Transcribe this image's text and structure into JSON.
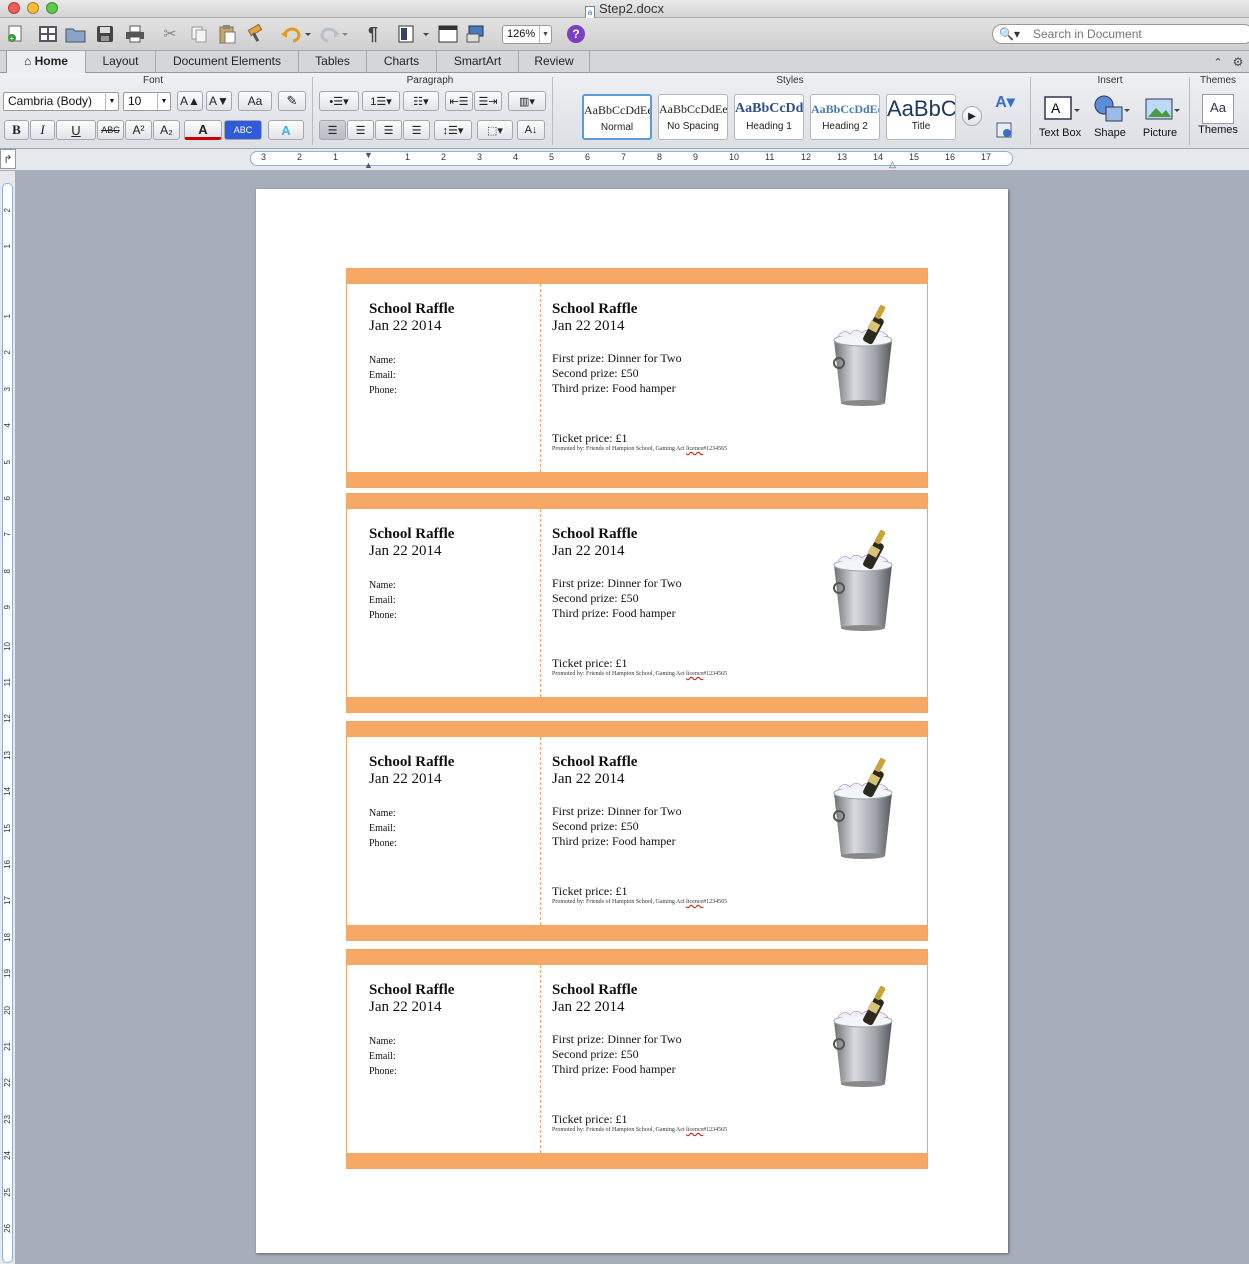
{
  "window": {
    "title": "Step2.docx"
  },
  "toolbar": {
    "zoom": "126%",
    "help": "?",
    "search_placeholder": "Search in Document"
  },
  "tabs": [
    "Home",
    "Layout",
    "Document Elements",
    "Tables",
    "Charts",
    "SmartArt",
    "Review"
  ],
  "ribbon": {
    "groups": {
      "font": "Font",
      "paragraph": "Paragraph",
      "styles": "Styles",
      "insert": "Insert",
      "themes": "Themes"
    },
    "font_name": "Cambria (Body)",
    "font_size": "10",
    "format_buttons": {
      "bold": "B",
      "italic": "I",
      "underline": "U",
      "strike": "ABC",
      "superscript": "A²",
      "subscript": "A₂",
      "font_color": "A",
      "highlight": "ABC",
      "text_effects": "A",
      "grow": "A▲",
      "shrink": "A▼",
      "change_case": "Aa"
    },
    "pilcrow": "¶",
    "styles": [
      {
        "preview": "AaBbCcDdEe",
        "name": "Normal"
      },
      {
        "preview": "AaBbCcDdEe",
        "name": "No Spacing"
      },
      {
        "preview": "AaBbCcDd",
        "name": "Heading 1"
      },
      {
        "preview": "AaBbCcDdEe",
        "name": "Heading 2"
      },
      {
        "preview": "AaBbC",
        "name": "Title"
      }
    ],
    "insert": [
      "Text Box",
      "Shape",
      "Picture"
    ],
    "themes": "Themes",
    "theme_preview": "Aa"
  },
  "ruler": {
    "h_labels": [
      "3",
      "2",
      "1",
      "1",
      "2",
      "3",
      "4",
      "5",
      "6",
      "7",
      "8",
      "9",
      "10",
      "11",
      "12",
      "13",
      "14",
      "15",
      "16",
      "17"
    ],
    "v_labels": [
      "2",
      "1",
      "1",
      "2",
      "3",
      "4",
      "5",
      "6",
      "7",
      "8",
      "9",
      "10",
      "11",
      "12",
      "13",
      "14",
      "15",
      "16",
      "17",
      "18",
      "19",
      "20",
      "21",
      "22",
      "23",
      "24",
      "25",
      "26"
    ]
  },
  "tickets": [
    {
      "title": "School Raffle",
      "date": "Jan 22 2014",
      "name_label": "Name:",
      "email_label": "Email:",
      "phone_label": "Phone:",
      "prizes": [
        "First prize: Dinner for Two",
        "Second prize: £50",
        "Third prize: Food hamper"
      ],
      "price": "Ticket price: £1",
      "promo_a": "Promoted by: Friends of Hampton School, Gaming Act",
      "promo_lic": "licence",
      "promo_b": "#1234565"
    },
    {
      "title": "School Raffle",
      "date": "Jan 22 2014",
      "name_label": "Name:",
      "email_label": "Email:",
      "phone_label": "Phone:",
      "prizes": [
        "First prize: Dinner for Two",
        "Second prize: £50",
        "Third prize: Food hamper"
      ],
      "price": "Ticket price: £1",
      "promo_a": "Promoted by: Friends of Hampton School, Gaming Act",
      "promo_lic": "licence",
      "promo_b": "#1234565"
    },
    {
      "title": "School Raffle",
      "date": "Jan 22 2014",
      "name_label": "Name:",
      "email_label": "Email:",
      "phone_label": "Phone:",
      "prizes": [
        "First prize: Dinner for Two",
        "Second prize: £50",
        "Third prize: Food hamper"
      ],
      "price": "Ticket price: £1",
      "promo_a": "Promoted by: Friends of Hampton School, Gaming Act",
      "promo_lic": "licence",
      "promo_b": "#1234565"
    },
    {
      "title": "School Raffle",
      "date": "Jan 22 2014",
      "name_label": "Name:",
      "email_label": "Email:",
      "phone_label": "Phone:",
      "prizes": [
        "First prize: Dinner for Two",
        "Second prize: £50",
        "Third prize: Food hamper"
      ],
      "price": "Ticket price: £1",
      "promo_a": "Promoted by: Friends of Hampton School, Gaming Act",
      "promo_lic": "licence",
      "promo_b": "#1234565"
    }
  ],
  "colors": {
    "ticket_band": "#f6a864",
    "ticket_border": "#f3a46b"
  }
}
